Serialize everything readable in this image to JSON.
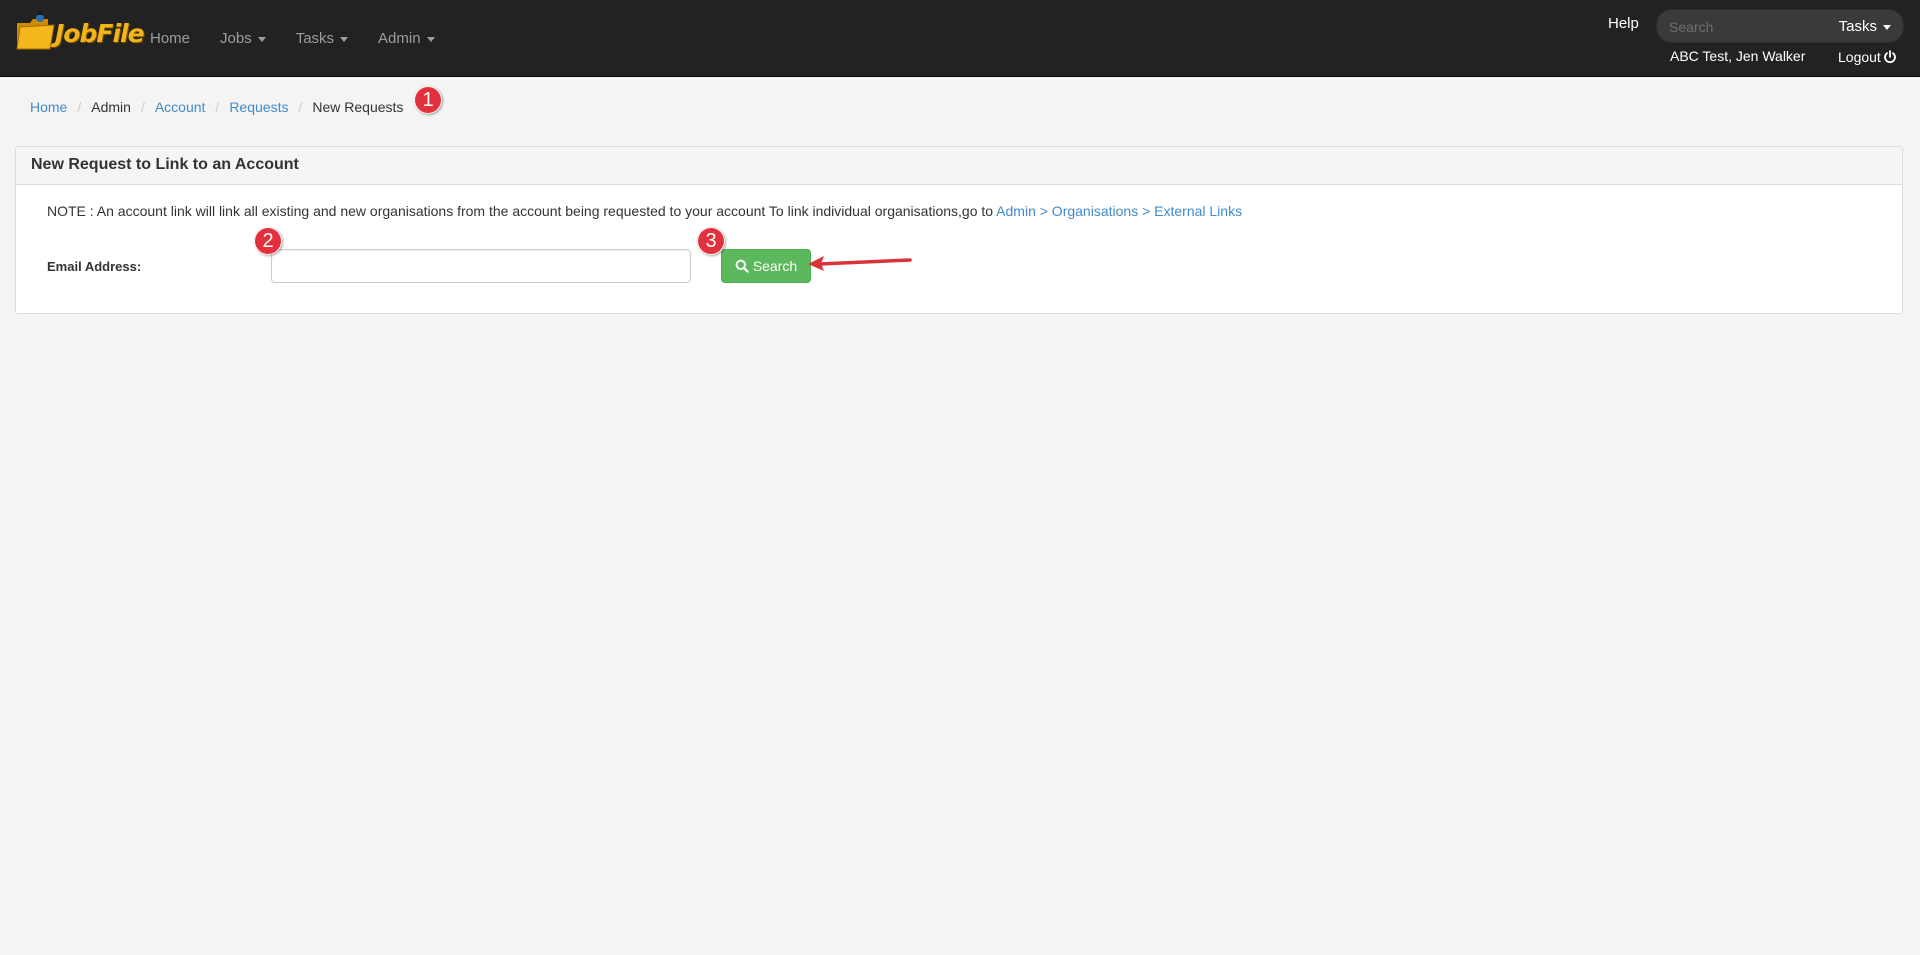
{
  "navbar": {
    "brand": "JobFile",
    "items": [
      {
        "label": "Home",
        "dropdown": false
      },
      {
        "label": "Jobs",
        "dropdown": true
      },
      {
        "label": "Tasks",
        "dropdown": true
      },
      {
        "label": "Admin",
        "dropdown": true
      }
    ],
    "help": "Help",
    "search_placeholder": "Search",
    "search_scope": "Tasks",
    "user": "ABC Test, Jen Walker",
    "logout": "Logout"
  },
  "breadcrumb": [
    {
      "label": "Home",
      "link": true
    },
    {
      "label": "Admin",
      "link": false
    },
    {
      "label": "Account",
      "link": true
    },
    {
      "label": "Requests",
      "link": true
    },
    {
      "label": "New Requests",
      "link": false
    }
  ],
  "annotations": [
    "1",
    "2",
    "3"
  ],
  "panel": {
    "title": "New Request to Link to an Account",
    "note_text": "NOTE : An account link will link all existing and new organisations from the account being requested to your account To link individual organisations,go to ",
    "note_link": "Admin > Organisations > External Links",
    "email_label": "Email Address:",
    "email_value": "",
    "search_button": "Search"
  },
  "colors": {
    "navbar_bg": "#222222",
    "link": "#428bca",
    "success": "#5cb85c",
    "badge": "#e2313c",
    "arrow": "#d9343a"
  }
}
